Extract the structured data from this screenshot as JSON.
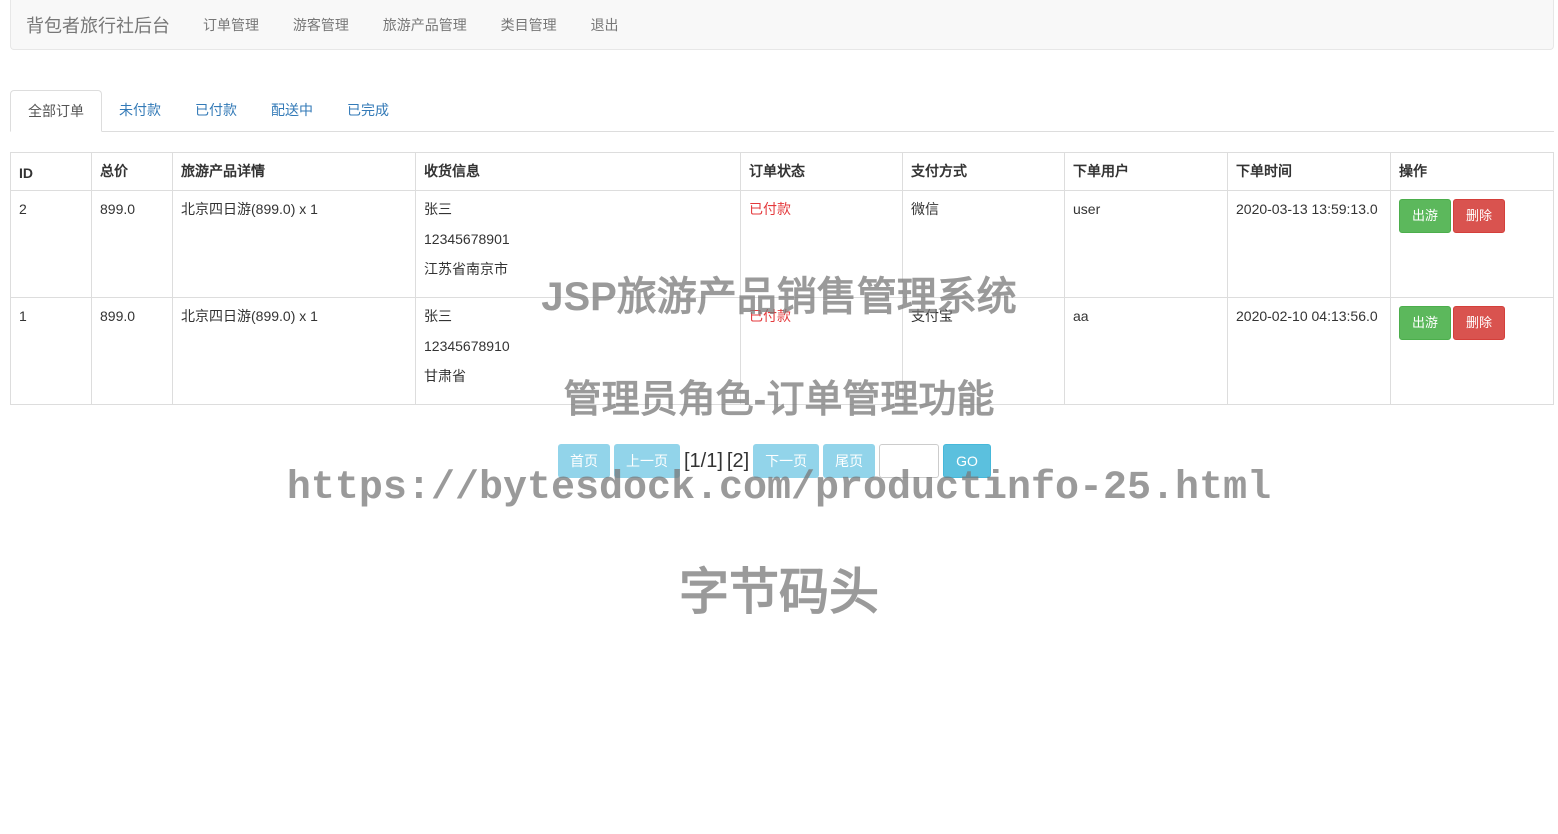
{
  "navbar": {
    "brand": "背包者旅行社后台",
    "items": [
      "订单管理",
      "游客管理",
      "旅游产品管理",
      "类目管理",
      "退出"
    ]
  },
  "tabs": [
    "全部订单",
    "未付款",
    "已付款",
    "配送中",
    "已完成"
  ],
  "table": {
    "headers": [
      "ID",
      "总价",
      "旅游产品详情",
      "收货信息",
      "订单状态",
      "支付方式",
      "下单用户",
      "下单时间",
      "操作"
    ],
    "rows": [
      {
        "id": "2",
        "total": "899.0",
        "detail": "北京四日游(899.0) x 1",
        "name": "张三",
        "phone": "12345678901",
        "address": "江苏省南京市",
        "status": "已付款",
        "payment": "微信",
        "user": "user",
        "time": "2020-03-13 13:59:13.0"
      },
      {
        "id": "1",
        "total": "899.0",
        "detail": "北京四日游(899.0) x 1",
        "name": "张三",
        "phone": "12345678910",
        "address": "甘肃省",
        "status": "已付款",
        "payment": "支付宝",
        "user": "aa",
        "time": "2020-02-10 04:13:56.0"
      }
    ],
    "ship_label": "出游",
    "delete_label": "删除"
  },
  "pager": {
    "first": "首页",
    "prev": "上一页",
    "info": "[1/1]",
    "page": "[2]",
    "next": "下一页",
    "last": "尾页",
    "input_value": "",
    "go": "GO"
  },
  "watermark": {
    "line1": "JSP旅游产品销售管理系统",
    "line2": "管理员角色-订单管理功能",
    "line3": "https://bytesdock.com/productinfo-25.html",
    "line4": "字节码头"
  },
  "colors": {
    "success": "#5cb85c",
    "danger": "#d9534f",
    "info": "#5bc0de",
    "status_red": "#e4393c"
  }
}
